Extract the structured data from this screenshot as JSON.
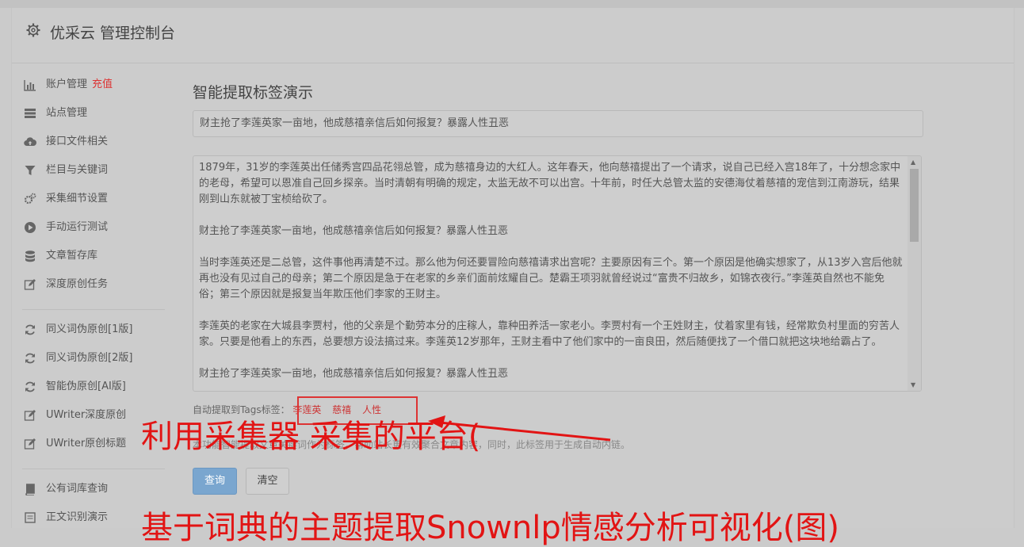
{
  "header": {
    "title": "优采云 管理控制台"
  },
  "sidebar": {
    "group1": [
      {
        "label": "账户管理",
        "extra": "充值",
        "icon": "bar-chart-icon"
      },
      {
        "label": "站点管理",
        "icon": "server-icon"
      },
      {
        "label": "接口文件相关",
        "icon": "cloud-upload-icon"
      },
      {
        "label": "栏目与关键词",
        "icon": "filter-icon"
      },
      {
        "label": "采集细节设置",
        "icon": "gears-icon"
      },
      {
        "label": "手动运行测试",
        "icon": "play-circle-icon"
      },
      {
        "label": "文章暂存库",
        "icon": "database-icon"
      },
      {
        "label": "深度原创任务",
        "icon": "edit-icon"
      }
    ],
    "group2": [
      {
        "label": "同义词伪原创[1版]",
        "icon": "refresh-icon"
      },
      {
        "label": "同义词伪原创[2版]",
        "icon": "refresh-icon"
      },
      {
        "label": "智能伪原创[AI版]",
        "icon": "refresh-icon"
      },
      {
        "label": "UWriter深度原创",
        "icon": "edit-icon"
      },
      {
        "label": "UWriter原创标题",
        "icon": "edit-icon"
      }
    ],
    "group3": [
      {
        "label": "公有词库查询",
        "icon": "book-icon"
      },
      {
        "label": "正文识别演示",
        "icon": "doc-icon"
      }
    ]
  },
  "main": {
    "page_title": "智能提取标签演示",
    "title_input_value": "财主抢了李莲英家一亩地，他成慈禧亲信后如何报复？暴露人性丑恶",
    "article_paragraphs": [
      "1879年，31岁的李莲英出任储秀宫四品花翎总管，成为慈禧身边的大红人。这年春天，他向慈禧提出了一个请求，说自己已经入宫18年了，十分想念家中的老母，希望可以恩准自己回乡探亲。当时清朝有明确的规定，太监无故不可以出宫。十年前，时任大总管太监的安德海仗着慈禧的宠信到江南游玩，结果刚到山东就被丁宝桢给砍了。",
      "财主抢了李莲英家一亩地，他成慈禧亲信后如何报复？暴露人性丑恶",
      "当时李莲英还是二总管，这件事他再清楚不过。那么他为何还要冒险向慈禧请求出宫呢？主要原因有三个。第一个原因是他确实想家了，从13岁入宫后他就再也没有见过自己的母亲；第二个原因是急于在老家的乡亲们面前炫耀自己。楚霸王项羽就曾经说过“富贵不归故乡，如锦衣夜行。”李莲英自然也不能免俗；第三个原因就是报复当年欺压他们李家的王财主。",
      "李莲英的老家在大城县李贾村，他的父亲是个勤劳本分的庄稼人，靠种田养活一家老小。李贾村有一个王姓财主，仗着家里有钱，经常欺负村里面的穷苦人家。只要是他看上的东西，总要想方设法搞过来。李莲英12岁那年，王财主看中了他们家中的一亩良田，然后随便找了一个借口就把这块地给霸占了。",
      "财主抢了李莲英家一亩地，他成慈禧亲信后如何报复？暴露人性丑恶"
    ],
    "tags_label": "自动提取到Tags标签：",
    "tags": [
      "李莲英",
      "慈禧",
      "人性"
    ],
    "hint": "本功能智能提取文章关键词作为标签，帮助站长更有效聚合文章内容，同时，此标签用于生成自动内链。",
    "query_button": "查询",
    "clear_button": "清空"
  },
  "overlay": {
    "caption1": "利用采集器 采集的平台(",
    "caption2": "基于词典的主题提取Snownlp情感分析可视化(图)"
  },
  "colors": {
    "overlay_red": "#e21414",
    "primary_button": "#7aa6cf",
    "accent_red": "#d33333"
  }
}
